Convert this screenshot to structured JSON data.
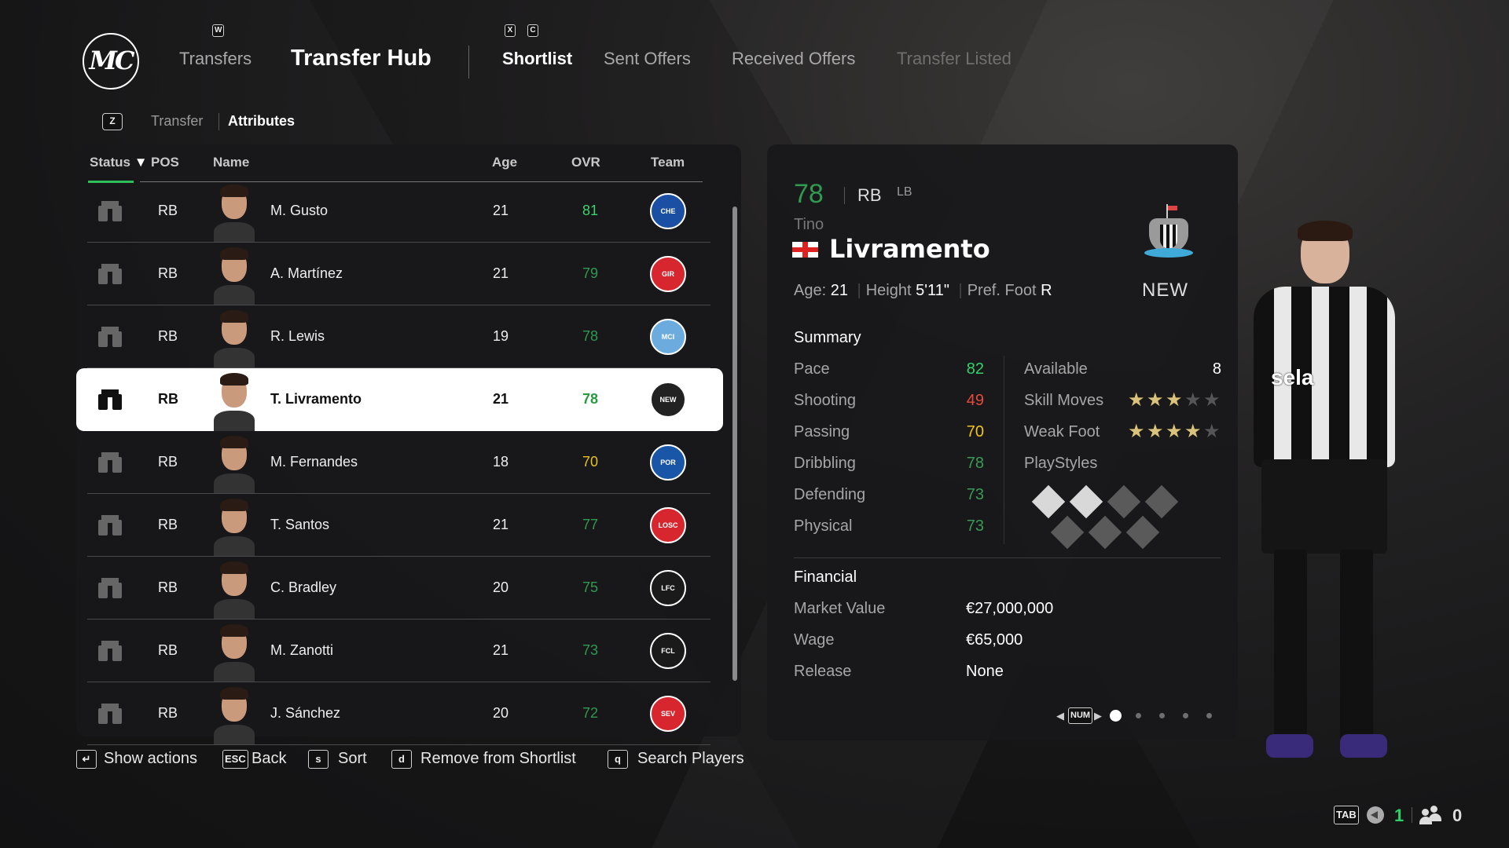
{
  "header": {
    "logo": "MC",
    "key_w": "W",
    "transfers": "Transfers",
    "hub_title": "Transfer Hub",
    "key_x": "X",
    "key_c": "C",
    "tabs": [
      {
        "label": "Shortlist",
        "active": true
      },
      {
        "label": "Sent Offers"
      },
      {
        "label": "Received Offers"
      },
      {
        "label": "Transfer Listed",
        "dim": true
      }
    ]
  },
  "subnav": {
    "key": "Z",
    "items": [
      "Transfer",
      "Attributes"
    ],
    "active": "Attributes"
  },
  "table": {
    "headers": {
      "status": "Status",
      "sort_icon": "▼",
      "pos": "POS",
      "name": "Name",
      "age": "Age",
      "ovr": "OVR",
      "team": "Team"
    },
    "rows": [
      {
        "pos": "RB",
        "name": "M. Gusto",
        "age": "21",
        "ovr": "81",
        "ovr_color": "#3bd36b",
        "team": "CHE",
        "team_color": "#1a4fa3"
      },
      {
        "pos": "RB",
        "name": "A. Martínez",
        "age": "21",
        "ovr": "79",
        "ovr_color": "#2f9a50",
        "team": "GIR",
        "team_color": "#d8262e"
      },
      {
        "pos": "RB",
        "name": "R. Lewis",
        "age": "19",
        "ovr": "78",
        "ovr_color": "#2f9a50",
        "team": "MCI",
        "team_color": "#6cabdd"
      },
      {
        "pos": "RB",
        "name": "T. Livramento",
        "age": "21",
        "ovr": "78",
        "ovr_color": "#2a9a40",
        "team": "NEW",
        "team_color": "#222",
        "selected": true
      },
      {
        "pos": "RB",
        "name": "M. Fernandes",
        "age": "18",
        "ovr": "70",
        "ovr_color": "#e8c020",
        "team": "POR",
        "team_color": "#1a56a8"
      },
      {
        "pos": "RB",
        "name": "T. Santos",
        "age": "21",
        "ovr": "77",
        "ovr_color": "#2f9a50",
        "team": "LOSC",
        "team_color": "#d8262e"
      },
      {
        "pos": "RB",
        "name": "C. Bradley",
        "age": "20",
        "ovr": "75",
        "ovr_color": "#2f9a50",
        "team": "LFC",
        "team_color": "#1a1a1a"
      },
      {
        "pos": "RB",
        "name": "M. Zanotti",
        "age": "21",
        "ovr": "73",
        "ovr_color": "#2f9a50",
        "team": "FCL",
        "team_color": "#1a1a1a"
      },
      {
        "pos": "RB",
        "name": "J. Sánchez",
        "age": "20",
        "ovr": "72",
        "ovr_color": "#2f9a50",
        "team": "SEV",
        "team_color": "#d8262e"
      }
    ]
  },
  "player": {
    "ovr": "78",
    "pos": "RB",
    "alt_pos": "LB",
    "first_name": "Tino",
    "last_name": "Livramento",
    "nation": "England",
    "club": "NEW",
    "age_label": "Age:",
    "age": "21",
    "height_label": "Height",
    "height": "5'11\"",
    "foot_label": "Pref. Foot",
    "foot": "R",
    "summary_title": "Summary",
    "stats": [
      {
        "label": "Pace",
        "value": "82",
        "color": "#33d26a"
      },
      {
        "label": "Shooting",
        "value": "49",
        "color": "#e5493a"
      },
      {
        "label": "Passing",
        "value": "70",
        "color": "#f0c419"
      },
      {
        "label": "Dribbling",
        "value": "78",
        "color": "#3a9a55"
      },
      {
        "label": "Defending",
        "value": "73",
        "color": "#3a9a55"
      },
      {
        "label": "Physical",
        "value": "73",
        "color": "#3a9a55"
      }
    ],
    "available_label": "Available",
    "available": "8",
    "skill_label": "Skill Moves",
    "skill_stars": 3,
    "weak_label": "Weak Foot",
    "weak_stars": 4,
    "playstyles_label": "PlayStyles",
    "playstyles_filled": 2,
    "playstyles_total": 7,
    "financial_title": "Financial",
    "market_label": "Market Value",
    "market": "€27,000,000",
    "wage_label": "Wage",
    "wage": "€65,000",
    "release_label": "Release",
    "release": "None",
    "pager": {
      "key": "NUM",
      "pages": 5,
      "current": 1
    }
  },
  "footer": {
    "hints": [
      {
        "key": "↵",
        "label": "Show actions"
      },
      {
        "key": "ESC",
        "label": "Back"
      },
      {
        "key": "s",
        "label": "Sort"
      },
      {
        "key": "d",
        "label": "Remove from Shortlist"
      },
      {
        "key": "q",
        "label": "Search Players"
      }
    ],
    "tab_key": "TAB",
    "voice_count": "1",
    "people_count": "0"
  },
  "colors": {
    "accent_green": "#2fbf5a",
    "star_gold": "#d9c27a"
  }
}
